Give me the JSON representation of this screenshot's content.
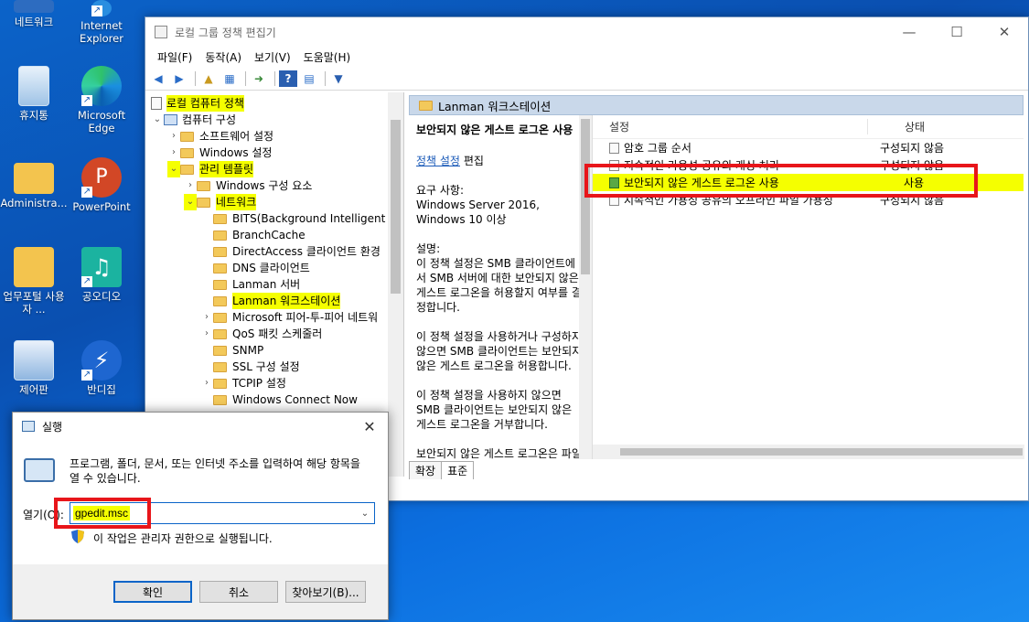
{
  "desktop": {
    "icons": [
      {
        "label": "네트워크"
      },
      {
        "label": "Internet Explorer"
      },
      {
        "label": "휴지통"
      },
      {
        "label": "Microsoft Edge"
      },
      {
        "label": "Administra..."
      },
      {
        "label": "PowerPoint"
      },
      {
        "label": "업무포털 사용자 ..."
      },
      {
        "label": "공오디오"
      },
      {
        "label": "제어판"
      },
      {
        "label": "반디집"
      }
    ]
  },
  "gpedit": {
    "title": "로컬 그룹 정책 편집기",
    "menu": [
      "파일(F)",
      "동작(A)",
      "보기(V)",
      "도움말(H)"
    ],
    "tree": [
      {
        "label": "로컬 컴퓨터 정책"
      },
      {
        "label": "컴퓨터 구성"
      },
      {
        "label": "소프트웨어 설정"
      },
      {
        "label": "Windows 설정"
      },
      {
        "label": "관리 템플릿"
      },
      {
        "label": "Windows 구성 요소"
      },
      {
        "label": "네트워크"
      },
      {
        "label": "BITS(Background Intelligent Tra"
      },
      {
        "label": "BranchCache"
      },
      {
        "label": "DirectAccess 클라이언트 환경"
      },
      {
        "label": "DNS 클라이언트"
      },
      {
        "label": "Lanman 서버"
      },
      {
        "label": "Lanman 워크스테이션"
      },
      {
        "label": "Microsoft 피어-투-피어 네트워"
      },
      {
        "label": "QoS 패킷 스케줄러"
      },
      {
        "label": "SNMP"
      },
      {
        "label": "SSL 구성 설정"
      },
      {
        "label": "TCPIP 설정"
      },
      {
        "label": "Windows Connect Now"
      }
    ],
    "right_header": "Lanman 워크스테이션",
    "desc": {
      "title": "보안되지 않은 게스트 로그온 사용",
      "link": "정책 설정",
      "edit": "편집",
      "req": "요구 사항:",
      "req_val": "Windows Server 2016, Windows 10 이상",
      "desc_label": "설명:",
      "p1": "이 정책 설정은 SMB 클라이언트에서 SMB 서버에 대한 보안되지 않은 게스트 로그온을 허용할지 여부를 결정합니다.",
      "p2": "이 정책 설정을 사용하거나 구성하지 않으면 SMB 클라이언트는 보안되지 않은 게스트 로그온을 허용합니다.",
      "p3": "이 정책 설정을 사용하지 않으면 SMB 클라이언트는 보안되지 않은 게스트 로그온을 거부합니다.",
      "p4": "보안되지 않은 게스트 로그온은 파일 서버에서 공유 폴더에 대한 인"
    },
    "list": {
      "col_setting": "설정",
      "col_state": "상태",
      "rows": [
        {
          "name": "암호 그룹 순서",
          "state": "구성되지 않음"
        },
        {
          "name": "지속적인 가용성 공유의 캐싱 처리",
          "state": "구성되지 않음"
        },
        {
          "name": "보안되지 않은 게스트 로그온 사용",
          "state": "사용"
        },
        {
          "name": "지속적인 가용성 공유의 오프라인 파일 가용성",
          "state": "구성되지 않음"
        }
      ]
    },
    "tabs": [
      "확장",
      "표준"
    ]
  },
  "run": {
    "title": "실행",
    "message": "프로그램, 폴더, 문서, 또는 인터넷 주소를 입력하여 해당 항목을 열 수 있습니다.",
    "open_label": "열기(O):",
    "value": "gpedit.msc",
    "note": "이 작업은 관리자 권한으로 실행됩니다.",
    "ok": "확인",
    "cancel": "취소",
    "browse": "찾아보기(B)..."
  },
  "colors": {
    "highlight": "#f5ff00",
    "annotation": "#e8151a"
  }
}
